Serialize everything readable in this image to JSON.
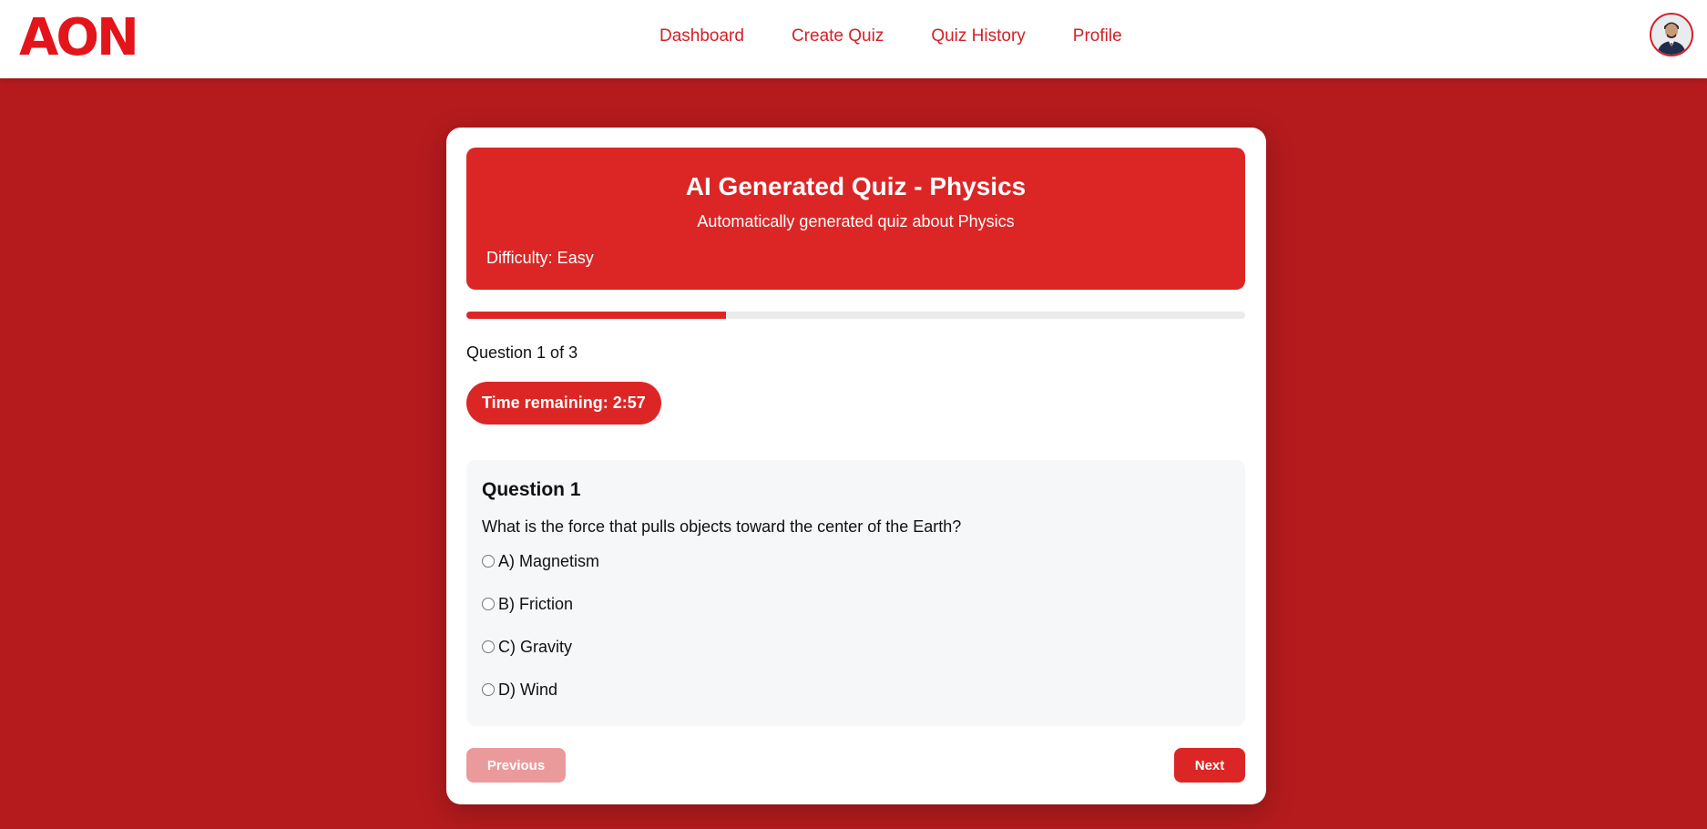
{
  "brand": {
    "logo_text": "AON",
    "accent": "#dc2626",
    "background": "#b51b1d"
  },
  "nav": {
    "links": [
      "Dashboard",
      "Create Quiz",
      "Quiz History",
      "Profile"
    ]
  },
  "user": {
    "avatar_icon": "user-avatar"
  },
  "quiz": {
    "title": "AI Generated Quiz - Physics",
    "description": "Automatically generated quiz about Physics",
    "difficulty": "Difficulty: Easy",
    "progress_fraction": 0.3333,
    "counter": "Question 1 of 3",
    "timer": "Time remaining: 2:57"
  },
  "question": {
    "heading": "Question 1",
    "text": "What is the force that pulls objects toward the center of the Earth?",
    "options": [
      "A) Magnetism",
      "B) Friction",
      "C) Gravity",
      "D) Wind"
    ]
  },
  "buttons": {
    "previous": "Previous",
    "next": "Next"
  }
}
